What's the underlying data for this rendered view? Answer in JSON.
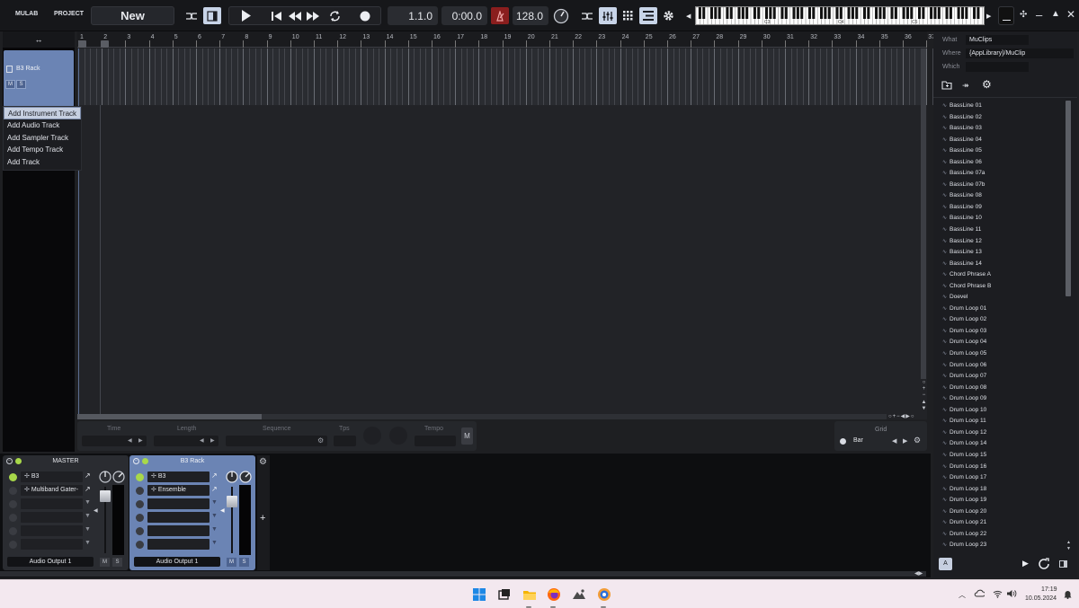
{
  "toolbar": {
    "app_name": "MULAB",
    "project_label": "PROJECT",
    "project_name": "New",
    "position": "1.1.0",
    "time": "0:00.0",
    "tempo": "128.0"
  },
  "keyboard": {
    "octave_labels": [
      "C3",
      "C4",
      "C5"
    ]
  },
  "trackpanel": {
    "header": "↔",
    "track_name": "B3 Rack",
    "mute_label": "M",
    "solo_label": "S"
  },
  "ruler": {
    "bars": [
      "1",
      "2",
      "3",
      "4",
      "5",
      "6",
      "7",
      "8",
      "9",
      "10",
      "11",
      "12",
      "13",
      "14",
      "15",
      "16",
      "17",
      "18",
      "19",
      "20",
      "21",
      "22",
      "23",
      "24",
      "25",
      "26",
      "27",
      "28",
      "29",
      "30",
      "31",
      "32",
      "33",
      "34",
      "35",
      "36",
      "37"
    ]
  },
  "context_menu": {
    "items": [
      "Add Instrument Track",
      "Add Audio Track",
      "Add Sampler Track",
      "Add Tempo Track",
      "Add Track"
    ]
  },
  "infobar": {
    "time_label": "Time",
    "length_label": "Length",
    "sequence_label": "Sequence",
    "tps_label": "Tps",
    "tempo_label": "Tempo",
    "m_label": "M",
    "grid_label": "Grid",
    "grid_value": "Bar"
  },
  "mixer": {
    "master": {
      "name": "MASTER",
      "slot1": "B3",
      "slot2": "Multiband Gater-",
      "output": "Audio Output 1",
      "mute": "M",
      "solo": "S"
    },
    "b3rack": {
      "name": "B3 Rack",
      "slot1": "B3",
      "slot2": "Ensemble",
      "output": "Audio Output 1",
      "mute": "M",
      "solo": "S"
    },
    "add_label": "+"
  },
  "browser": {
    "what_label": "What",
    "what_value": "MuClips",
    "where_label": "Where",
    "where_value": "{AppLibrary}/MuClip",
    "which_label": "Which",
    "which_value": "",
    "bottom_letter": "A",
    "clips": [
      "BassLine 01",
      "BassLine 02",
      "BassLine 03",
      "BassLine 04",
      "BassLine 05",
      "BassLine 06",
      "BassLine 07a",
      "BassLine 07b",
      "BassLine 08",
      "BassLine 09",
      "BassLine 10",
      "BassLine 11",
      "BassLine 12",
      "BassLine 13",
      "BassLine 14",
      "Chord Phrase A",
      "Chord Phrase B",
      "Doevel",
      "Drum Loop 01",
      "Drum Loop 02",
      "Drum Loop 03",
      "Drum Loop 04",
      "Drum Loop 05",
      "Drum Loop 06",
      "Drum Loop 07",
      "Drum Loop 08",
      "Drum Loop 09",
      "Drum Loop 10",
      "Drum Loop 11",
      "Drum Loop 12",
      "Drum Loop 14",
      "Drum Loop 15",
      "Drum Loop 16",
      "Drum Loop 17",
      "Drum Loop 18",
      "Drum Loop 19",
      "Drum Loop 20",
      "Drum Loop 21",
      "Drum Loop 22",
      "Drum Loop 23"
    ]
  },
  "taskbar": {
    "time": "17:19",
    "date": "10.05.2024"
  }
}
